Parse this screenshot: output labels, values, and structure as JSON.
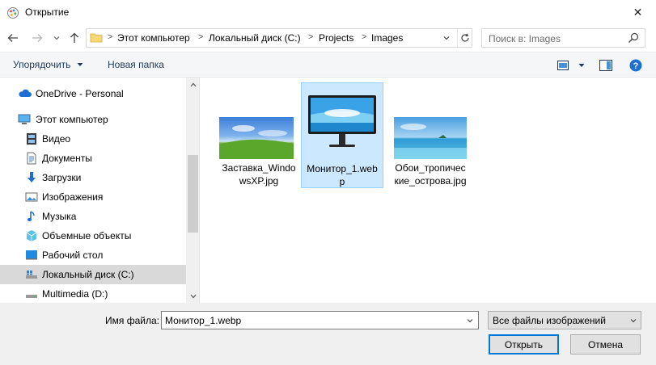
{
  "window": {
    "title": "Открытие",
    "close_glyph": "✕"
  },
  "nav": {
    "back_icon": "arrow-left-icon",
    "forward_icon": "arrow-right-icon",
    "recent_icon": "chevron-down-icon",
    "up_icon": "arrow-up-icon"
  },
  "address": {
    "separator": ">",
    "crumbs": [
      "Этот компьютер",
      "Локальный диск (C:)",
      "Projects",
      "Images"
    ]
  },
  "search": {
    "placeholder": "Поиск в: Images"
  },
  "toolbar": {
    "organize_label": "Упорядочить",
    "new_folder_label": "Новая папка"
  },
  "sidebar": {
    "items": [
      {
        "label": "OneDrive - Personal",
        "icon": "cloud-icon"
      },
      {
        "label": "Этот компьютер",
        "icon": "computer-icon"
      },
      {
        "label": "Видео",
        "icon": "video-icon"
      },
      {
        "label": "Документы",
        "icon": "documents-icon"
      },
      {
        "label": "Загрузки",
        "icon": "download-icon"
      },
      {
        "label": "Изображения",
        "icon": "pictures-icon"
      },
      {
        "label": "Музыка",
        "icon": "music-icon"
      },
      {
        "label": "Объемные объекты",
        "icon": "3d-objects-icon"
      },
      {
        "label": "Рабочий стол",
        "icon": "desktop-icon"
      },
      {
        "label": "Локальный диск (C:)",
        "icon": "drive-icon",
        "selected": true
      },
      {
        "label": "Multimedia (D:)",
        "icon": "drive-icon"
      }
    ]
  },
  "files": [
    {
      "name": "Заставка_WindowsXP.jpg",
      "line1": "Заставка_Windo",
      "line2": "wsXP.jpg",
      "thumb": "bliss"
    },
    {
      "name": "Монитор_1.webp",
      "line1": "Монитор_1.web",
      "line2": "p",
      "thumb": "monitor",
      "selected": true
    },
    {
      "name": "Обои_тропические_острова.jpg",
      "line1": "Обои_тропичес",
      "line2": "кие_острова.jpg",
      "thumb": "tropics"
    }
  ],
  "footer": {
    "filename_label": "Имя файла:",
    "filename_value": "Монитор_1.webp",
    "filter_value": "Все файлы изображений",
    "open_label": "Открыть",
    "cancel_label": "Отмена"
  },
  "colors": {
    "selection": "#cce8ff",
    "selection_border": "#99d1ff",
    "accent": "#0078d7",
    "toolbar_bg": "#f5f6f7"
  }
}
